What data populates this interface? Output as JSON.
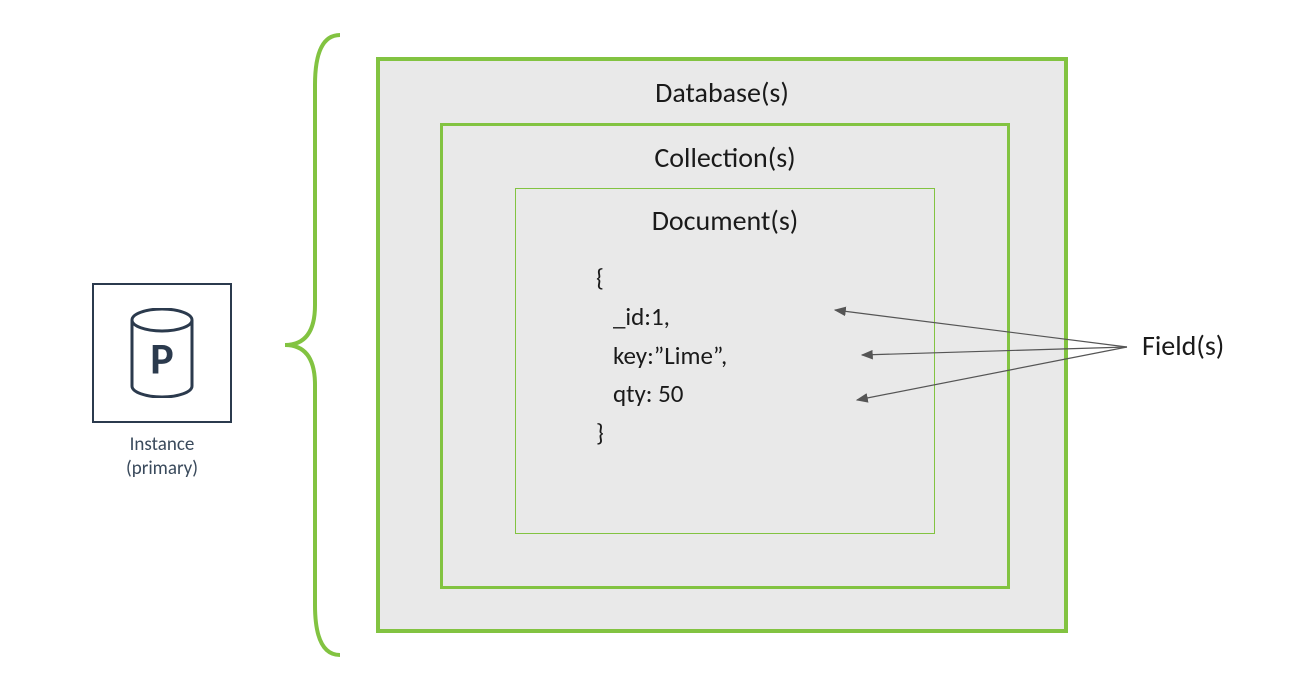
{
  "instance": {
    "letter": "P",
    "label_line1": "Instance",
    "label_line2": "(primary)"
  },
  "database": {
    "title": "Database(s)"
  },
  "collection": {
    "title": "Collection(s)"
  },
  "document": {
    "title": "Document(s)",
    "content": "{\n   _id:1,\n   key:”Lime”,\n   qty: 50\n}"
  },
  "fields": {
    "label": "Field(s)"
  }
}
